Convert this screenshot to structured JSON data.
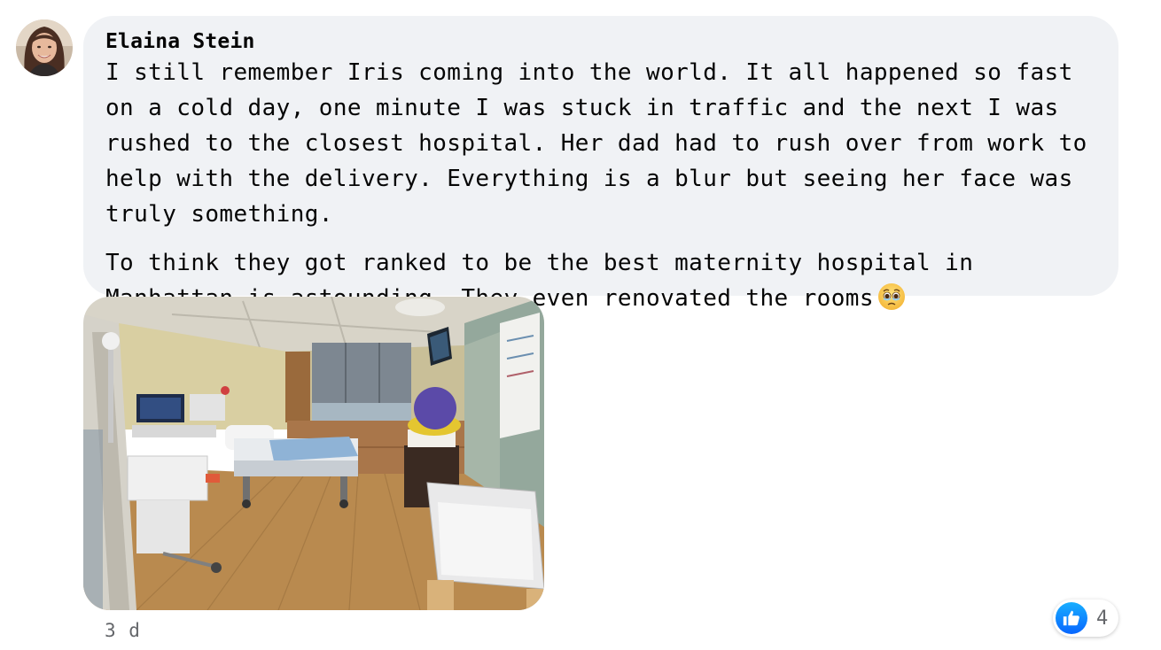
{
  "comment": {
    "author": "Elaina Stein",
    "paragraphs": [
      "I still remember Iris coming into the world. It all happened so fast on a cold day, one minute I was stuck in traffic and the next I was rushed to the closest hospital. Her dad had to rush over from work to help with the delivery. Everything is a blur but seeing her face was truly something.",
      "To think they got ranked to be the best maternity hospital in Manhattan is astounding. They even renovated the rooms"
    ],
    "emoji": "face-holding-back-tears-emoji",
    "timestamp": "3 d",
    "reaction_icon": "like-icon",
    "reaction_count": "4"
  },
  "colors": {
    "bubble_bg": "#f0f2f5",
    "like_blue": "#0866ff",
    "secondary_text": "#65676b"
  }
}
